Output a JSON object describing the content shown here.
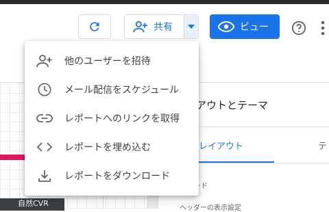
{
  "toolbar": {
    "share_label": "共有",
    "view_label": "ビュー"
  },
  "menu": {
    "items": [
      {
        "label": "他のユーザーを招待",
        "icon": "add-person-icon"
      },
      {
        "label": "メール配信をスケジュール",
        "icon": "clock-icon"
      },
      {
        "label": "レポートへのリンクを取得",
        "icon": "link-icon"
      },
      {
        "label": "レポートを埋め込む",
        "icon": "embed-code-icon"
      },
      {
        "label": "レポートをダウンロード",
        "icon": "download-icon"
      }
    ]
  },
  "panel": {
    "title": "アウトとテーマ",
    "tab_layout": "レイアウト",
    "tab_theme": "テ",
    "section_label": "ード",
    "header_label": "ヘッダーの表示設定"
  },
  "canvas": {
    "chip_label": "自然CVR"
  },
  "colors": {
    "accent": "#1a73e8",
    "canvas_bar": "#d81b60"
  }
}
